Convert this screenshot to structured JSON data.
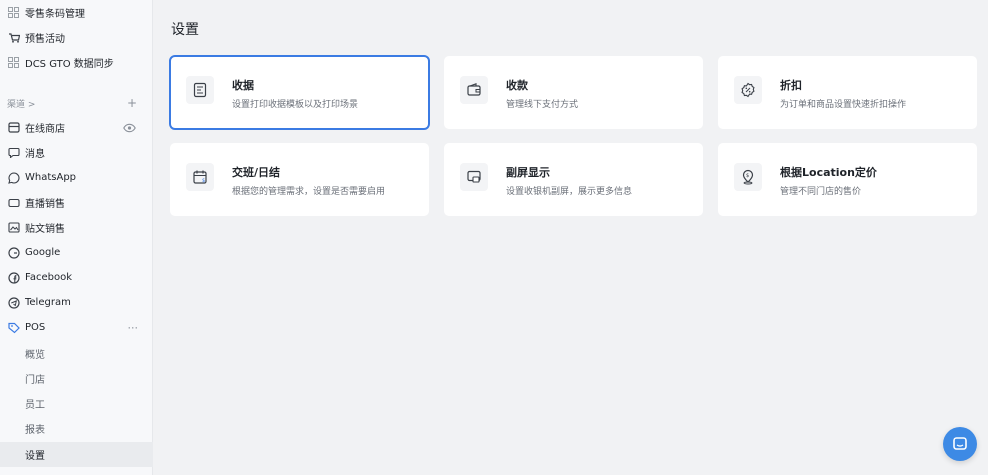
{
  "sidebar": {
    "top_items": [
      {
        "label": "零售条码管理",
        "icon": "barcode-icon"
      },
      {
        "label": "预售活动",
        "icon": "presale-icon"
      },
      {
        "label": "DCS GTO 数据同步",
        "icon": "sync-icon"
      }
    ],
    "channels_label": "渠道 >",
    "channels_add": "+",
    "channels": [
      {
        "label": "在线商店",
        "icon": "store-icon"
      },
      {
        "label": "消息",
        "icon": "message-icon"
      },
      {
        "label": "WhatsApp",
        "icon": "whatsapp-icon"
      },
      {
        "label": "直播销售",
        "icon": "live-icon"
      },
      {
        "label": "贴文销售",
        "icon": "post-icon"
      },
      {
        "label": "Google",
        "icon": "google-icon"
      },
      {
        "label": "Facebook",
        "icon": "facebook-icon"
      },
      {
        "label": "Telegram",
        "icon": "telegram-icon"
      },
      {
        "label": "POS",
        "icon": "pos-icon"
      }
    ],
    "pos_more": "···",
    "pos_sub": [
      {
        "label": "概览"
      },
      {
        "label": "门店"
      },
      {
        "label": "员工"
      },
      {
        "label": "报表"
      },
      {
        "label": "设置",
        "active": true
      }
    ]
  },
  "main": {
    "title": "设置",
    "cards": [
      {
        "title": "收据",
        "desc": "设置打印收据模板以及打印场景",
        "icon": "receipt-icon",
        "selected": true
      },
      {
        "title": "收款",
        "desc": "管理线下支付方式",
        "icon": "wallet-icon"
      },
      {
        "title": "折扣",
        "desc": "为订单和商品设置快速折扣操作",
        "icon": "discount-icon"
      },
      {
        "title": "交班/日结",
        "desc": "根据您的管理需求，设置是否需要启用",
        "icon": "shift-calendar-icon"
      },
      {
        "title": "副屏显示",
        "desc": "设置收银机副屏，展示更多信息",
        "icon": "second-screen-icon"
      },
      {
        "title": "根据Location定价",
        "desc": "管理不同门店的售价",
        "icon": "location-price-icon"
      }
    ]
  },
  "colors": {
    "accent": "#3b7be3",
    "chat": "#3d8ae5",
    "background": "#f1f2f4",
    "sidebar": "#f7f8fa"
  }
}
